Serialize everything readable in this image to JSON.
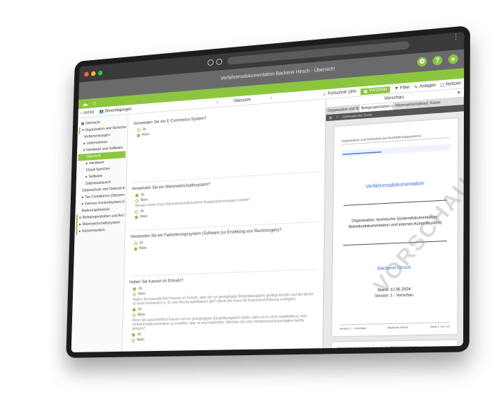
{
  "app": {
    "title": "Verfahrensdokumentation Bäckerei Hirsch - Übersicht",
    "brand_color": "#8cc63f"
  },
  "toolbar": {
    "back_label": "zurück",
    "permissions_label": "Berechtigungen",
    "overview_label": "Übersicht",
    "progress_label": "Fortschritt 18%",
    "preview_label": "Vorschau",
    "filter_label": "Filter",
    "attachments_label": "Anlagen",
    "notes_label": "Notizen"
  },
  "sidebar": {
    "items": [
      {
        "label": "Übersicht"
      },
      {
        "label": "Organisation und Sicherheit"
      },
      {
        "label": "Vorbemerkungen"
      },
      {
        "label": "Unternehmen"
      },
      {
        "label": "Hardware und Software"
      },
      {
        "label": "Übersicht"
      },
      {
        "label": "Hardware"
      },
      {
        "label": "Cloud-Speicher"
      },
      {
        "label": "Software"
      },
      {
        "label": "Datenaustausch"
      },
      {
        "label": "Datenschutz und Datensicherheit"
      },
      {
        "label": "Tax Compliance (Steuerehrlichkeit)"
      },
      {
        "label": "Internes Kontrollsystem (IKS)"
      },
      {
        "label": "Änderungshistorie"
      },
      {
        "label": "Belegorganisation und Archivierung"
      },
      {
        "label": "Warenwirtschaftssystem"
      },
      {
        "label": "Kassensystem"
      }
    ]
  },
  "questions": [
    {
      "title": "Verwenden Sie ein E-Commerce System?",
      "options": [
        "Ja",
        "Nein"
      ]
    },
    {
      "title": "Verwenden Sie ein Warenwirtschaftssystem?",
      "options": [
        "Ja",
        "Nein"
      ],
      "note": "Werden mittels Ihres Warenwirtschaftssystems Ausgangsrechnungen erstellt?",
      "options2": [
        "Ja",
        "Nein"
      ]
    },
    {
      "title": "Verwenden Sie ein Fakturierungssystem (Software zur Erstellung von Rechnungen)?",
      "options": [
        "Ja",
        "Nein"
      ]
    },
    {
      "title": "Haben Sie Kassen im Einsatz?",
      "options": [
        "Ja",
        "Nein"
      ],
      "note": "Haben Sie ausschließlich Kassen im Einsatz, über die nur geringfügige Bargeldausgaben getätigt werden und bei denen es keine Einnahmen (z. B. eine Wechselgeldkasse) gibt? (Auch hier muss die Kassenbuchführung vorliegen)",
      "options2": [
        "Ja",
        "Nein"
      ],
      "note2": "Wenn Sie ausschließlich Kassen mit nur geringfügigen Bargeldausgaben haben, dann ist es nicht verpflichtend, eine Verfahrensdokumentation zu erstellen, aber es wird empfohlen. Möchten Sie eine Verfahrensdokumentation hierfür anlegen?",
      "options3": [
        "Ja",
        "Nein"
      ]
    }
  ],
  "preview": {
    "title": "Vorschau",
    "tabs": [
      "Organisation und Sic...",
      "Belegorganisation un...",
      "Warenwirtschaftssys...",
      "Kasse"
    ],
    "tool_text": "Automatischer Zoom",
    "page_header": "Organisation und Sicherheit des Buchführungssystems",
    "doc_title": "Verfahrensdokumentation",
    "doc_subtitle": "Organisation, technische Systemdokumentation, Betriebsdokumentation und internes Kontrollsystem",
    "company": "Bäckerei Hirsch",
    "stand": "Stand: 12.06.2024",
    "version": "Version: 1 - Vorschau",
    "watermark": "VORSCHAU",
    "footer_left": "Version 1 - Vorschau",
    "footer_mid": "Bäckerei Hirsch",
    "footer_right": "Seite 1 von 13",
    "page2_header": "Organisation und Sicherheit des Buchführungssystems"
  }
}
